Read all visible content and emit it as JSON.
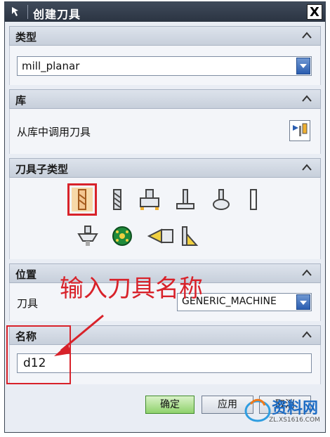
{
  "window": {
    "title": "创建刀具",
    "close": "X"
  },
  "sections": {
    "type": {
      "label": "类型",
      "value": "mill_planar"
    },
    "library": {
      "label": "库",
      "text": "从库中调用刀具"
    },
    "subtype": {
      "label": "刀具子类型",
      "tools": [
        "mill-tool-icon",
        "drill-fluted-tool-icon",
        "face-mill-tool-icon",
        "t-cutter-tool-icon",
        "barrel-tool-icon",
        "chamfer-tool-icon",
        "thread-mill-tool-icon",
        "ball-cutter-tool-icon",
        "spot-drill-tool-icon",
        "form-tool-icon"
      ]
    },
    "position": {
      "label": "位置",
      "field_label": "刀具",
      "value": "GENERIC_MACHINE"
    },
    "name": {
      "label": "名称",
      "value": "d12"
    }
  },
  "buttons": {
    "ok": "确定",
    "apply": "应用",
    "cancel": "取消"
  },
  "annotation": {
    "text": "输入刀具名称"
  },
  "watermark": {
    "text": "资料网",
    "sub": "ZL.XS1616.COM"
  },
  "colors": {
    "accent": "#2a5db0",
    "annotation": "#d8222a",
    "ok_button": "#8fd26c"
  }
}
